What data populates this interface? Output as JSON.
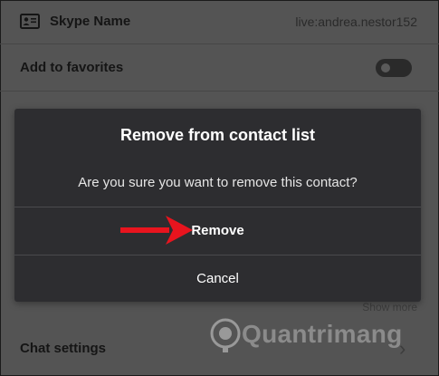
{
  "profile": {
    "skype_name_label": "Skype Name",
    "skype_name_value": "live:andrea.nestor152",
    "favorites_label": "Add to favorites",
    "favorites_enabled": false,
    "show_more": "Show more",
    "chat_settings": "Chat settings"
  },
  "dialog": {
    "title": "Remove from contact list",
    "message": "Are you sure you want to remove this contact?",
    "confirm_label": "Remove",
    "cancel_label": "Cancel"
  },
  "watermark": {
    "text": "Quantrimang"
  },
  "colors": {
    "overlay": "#545454",
    "dialog": "#2d2d30",
    "arrow": "#e8141e"
  },
  "icons": [
    "contact-card-icon",
    "toggle-switch",
    "chevron-right-icon",
    "arrow-pointer-icon",
    "lightbulb-logo-icon"
  ]
}
